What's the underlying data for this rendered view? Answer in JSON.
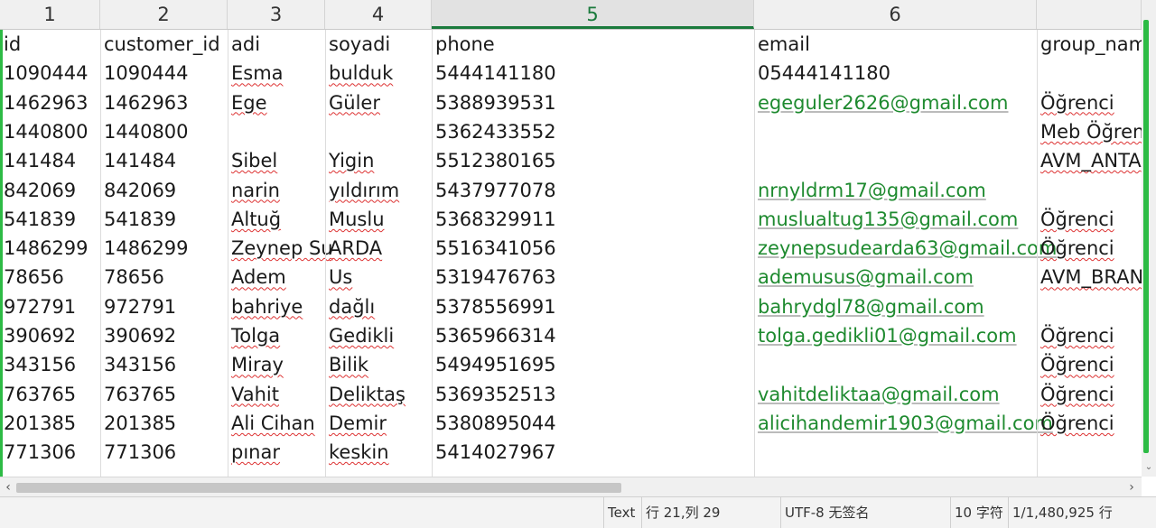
{
  "columns": [
    {
      "label": "1",
      "active": false
    },
    {
      "label": "2",
      "active": false
    },
    {
      "label": "3",
      "active": false
    },
    {
      "label": "4",
      "active": false
    },
    {
      "label": "5",
      "active": true
    },
    {
      "label": "6",
      "active": false
    },
    {
      "label": "",
      "active": false
    }
  ],
  "rows": [
    [
      "id",
      "customer_id",
      "adi",
      "soyadi",
      "phone",
      "email",
      "group_nam"
    ],
    [
      "1090444",
      "1090444",
      "Esma",
      "bulduk",
      "5444141180",
      "05444141180",
      ""
    ],
    [
      "1462963",
      "1462963",
      "Ege",
      "Güler",
      "5388939531",
      "egeguler2626@gmail.com",
      "Öğrenci"
    ],
    [
      "1440800",
      "1440800",
      "",
      "",
      "5362433552",
      "",
      "Meb Öğren"
    ],
    [
      "141484",
      "141484",
      "Sibel",
      "Yigin",
      "5512380165",
      "",
      "AVM_ANTA"
    ],
    [
      "842069",
      "842069",
      "narin",
      "yıldırım",
      "5437977078",
      "nrnyldrm17@gmail.com",
      ""
    ],
    [
      "541839",
      "541839",
      "Altuğ",
      "Muslu",
      "5368329911",
      "muslualtug135@gmail.com",
      "Öğrenci"
    ],
    [
      "1486299",
      "1486299",
      "Zeynep Su",
      "ARDA",
      "5516341056",
      "zeynepsudearda63@gmail.com",
      "Öğrenci"
    ],
    [
      "78656",
      "78656",
      "Adem",
      "Us",
      "5319476763",
      "ademusus@gmail.com",
      "AVM_BRAN"
    ],
    [
      "972791",
      "972791",
      "bahriye",
      "dağlı",
      "5378556991",
      "bahrydgl78@gmail.com",
      ""
    ],
    [
      "390692",
      "390692",
      "Tolga",
      "Gedikli",
      "5365966314",
      "tolga.gedikli01@gmail.com",
      "Öğrenci"
    ],
    [
      "343156",
      "343156",
      "Miray",
      "Bilik",
      "5494951695",
      "",
      "Öğrenci"
    ],
    [
      "763765",
      "763765",
      "Vahit",
      "Deliktaş",
      "5369352513",
      "vahitdeliktaa@gmail.com",
      "Öğrenci"
    ],
    [
      "201385",
      "201385",
      "Ali Cihan",
      "Demir",
      "5380895044",
      "alicihandemir1903@gmail.com",
      "Öğrenci"
    ],
    [
      "771306",
      "771306",
      "pınar",
      "keskin",
      "5414027967",
      "",
      ""
    ],
    [
      "",
      "",
      "",
      "",
      "",
      "",
      ""
    ]
  ],
  "hscroll": {
    "left": "‹",
    "right": "›"
  },
  "vscroll": {
    "down": "⌄"
  },
  "status": {
    "mode": "Text",
    "position": "行 21,列 29",
    "encoding": "UTF-8 无签名",
    "chars": "10 字符",
    "lines": "1/1,480,925 行"
  }
}
